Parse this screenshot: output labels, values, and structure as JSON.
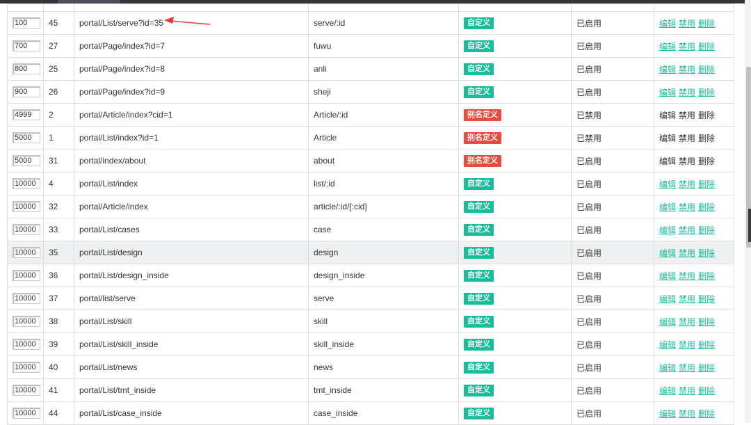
{
  "colors": {
    "custom_badge": "#1abc9c",
    "alias_badge": "#e74c3c",
    "link": "#18bc9c",
    "highlight_row": "#eef0f1"
  },
  "actions": {
    "edit": "编辑",
    "disable": "禁用",
    "delete": "删除"
  },
  "rows": [
    {
      "order": "100",
      "id": "45",
      "url": "portal/List/serve?id=35",
      "alias": "serve/:id",
      "type": "自定义",
      "kind": "custom",
      "status": "已启用",
      "actions_enabled": true
    },
    {
      "order": "700",
      "id": "27",
      "url": "portal/Page/index?id=7",
      "alias": "fuwu",
      "type": "自定义",
      "kind": "custom",
      "status": "已启用",
      "actions_enabled": true
    },
    {
      "order": "800",
      "id": "25",
      "url": "portal/Page/index?id=8",
      "alias": "anli",
      "type": "自定义",
      "kind": "custom",
      "status": "已启用",
      "actions_enabled": true
    },
    {
      "order": "900",
      "id": "26",
      "url": "portal/Page/index?id=9",
      "alias": "sheji",
      "type": "自定义",
      "kind": "custom",
      "status": "已启用",
      "actions_enabled": true
    },
    {
      "order": "4999",
      "id": "2",
      "url": "portal/Article/index?cid=1",
      "alias": "Article/:id",
      "type": "别名定义",
      "kind": "alias",
      "status": "已禁用",
      "actions_enabled": false
    },
    {
      "order": "5000",
      "id": "1",
      "url": "portal/List/index?id=1",
      "alias": "Article",
      "type": "别名定义",
      "kind": "alias",
      "status": "已禁用",
      "actions_enabled": false
    },
    {
      "order": "5000",
      "id": "31",
      "url": "portal/index/about",
      "alias": "about",
      "type": "别名定义",
      "kind": "alias",
      "status": "已启用",
      "actions_enabled": false
    },
    {
      "order": "10000",
      "id": "4",
      "url": "portal/List/index",
      "alias": "list/:id",
      "type": "自定义",
      "kind": "custom",
      "status": "已启用",
      "actions_enabled": true
    },
    {
      "order": "10000",
      "id": "32",
      "url": "portal/Article/index",
      "alias": "article/:id/[:cid]",
      "type": "自定义",
      "kind": "custom",
      "status": "已启用",
      "actions_enabled": true
    },
    {
      "order": "10000",
      "id": "33",
      "url": "portal/List/cases",
      "alias": "case",
      "type": "自定义",
      "kind": "custom",
      "status": "已启用",
      "actions_enabled": true
    },
    {
      "order": "10000",
      "id": "35",
      "url": "portal/List/design",
      "alias": "design",
      "type": "自定义",
      "kind": "custom",
      "status": "已启用",
      "actions_enabled": true,
      "highlighted": true
    },
    {
      "order": "10000",
      "id": "36",
      "url": "portal/List/design_inside",
      "alias": "design_inside",
      "type": "自定义",
      "kind": "custom",
      "status": "已启用",
      "actions_enabled": true
    },
    {
      "order": "10000",
      "id": "37",
      "url": "portal/list/serve",
      "alias": "serve",
      "type": "自定义",
      "kind": "custom",
      "status": "已启用",
      "actions_enabled": true
    },
    {
      "order": "10000",
      "id": "38",
      "url": "portal/List/skill",
      "alias": "skill",
      "type": "自定义",
      "kind": "custom",
      "status": "已启用",
      "actions_enabled": true
    },
    {
      "order": "10000",
      "id": "39",
      "url": "portal/List/skill_inside",
      "alias": "skill_inside",
      "type": "自定义",
      "kind": "custom",
      "status": "已启用",
      "actions_enabled": true
    },
    {
      "order": "10000",
      "id": "40",
      "url": "portal/List/news",
      "alias": "news",
      "type": "自定义",
      "kind": "custom",
      "status": "已启用",
      "actions_enabled": true
    },
    {
      "order": "10000",
      "id": "41",
      "url": "portal/List/tmt_inside",
      "alias": "tmt_inside",
      "type": "自定义",
      "kind": "custom",
      "status": "已启用",
      "actions_enabled": true
    },
    {
      "order": "10000",
      "id": "44",
      "url": "portal/List/case_inside",
      "alias": "case_inside",
      "type": "自定义",
      "kind": "custom",
      "status": "已启用",
      "actions_enabled": true
    }
  ]
}
